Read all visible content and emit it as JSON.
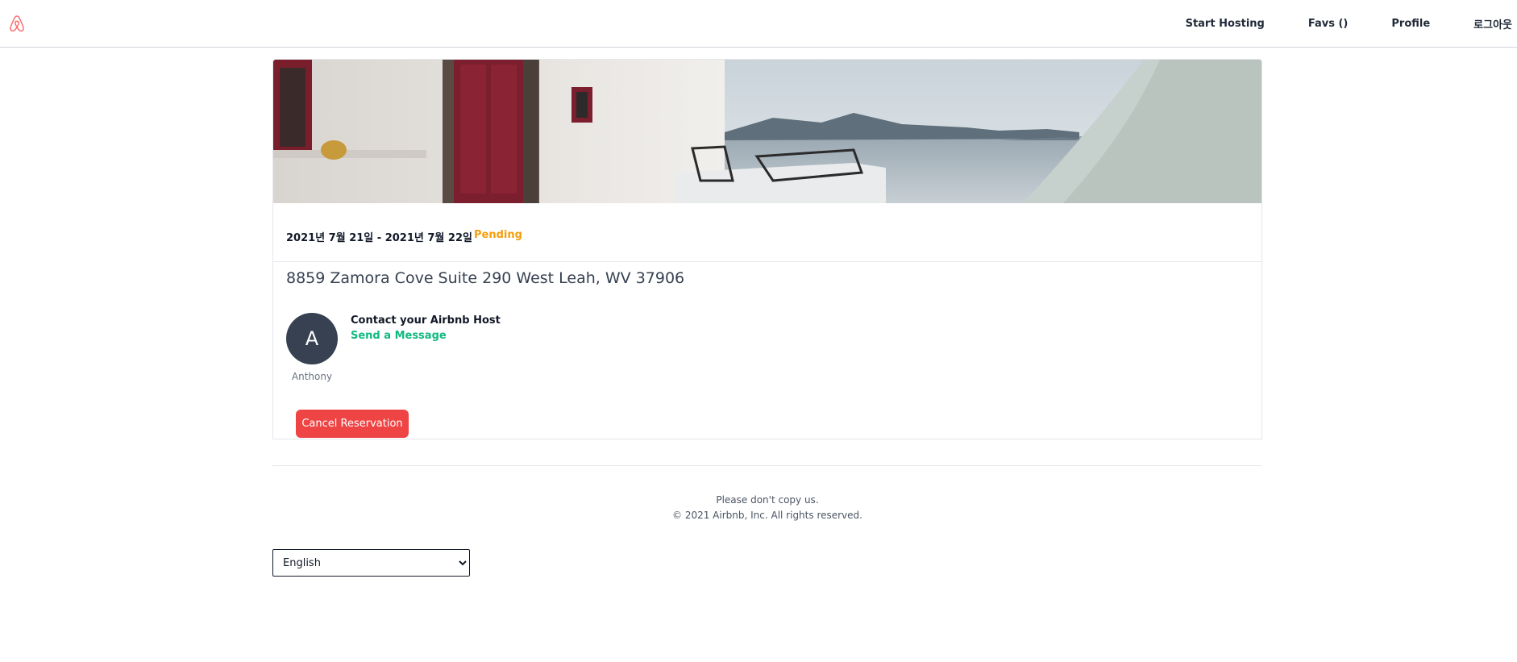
{
  "nav": {
    "logo_icon": "airbnb-logo-icon",
    "brand_color": "#f87171",
    "links": [
      "Start Hosting",
      "Favs ()",
      "Profile",
      "로그아웃"
    ]
  },
  "reservation": {
    "dates": "2021년 7월 21일 - 2021년 7월 22일",
    "status": "Pending",
    "status_color": "#f59e0b",
    "address": "8859 Zamora Cove Suite 290 West Leah, WV 37906",
    "host": {
      "initial": "A",
      "name": "Anthony",
      "contact_title": "Contact your Airbnb Host",
      "send_message": "Send a Message"
    },
    "cancel_label": "Cancel Reservation",
    "cancel_color": "#ef4444"
  },
  "footer": {
    "line1": "Please don't copy us.",
    "line2": "© 2021 Airbnb, Inc. All rights reserved.",
    "language": {
      "selected": "English"
    }
  }
}
